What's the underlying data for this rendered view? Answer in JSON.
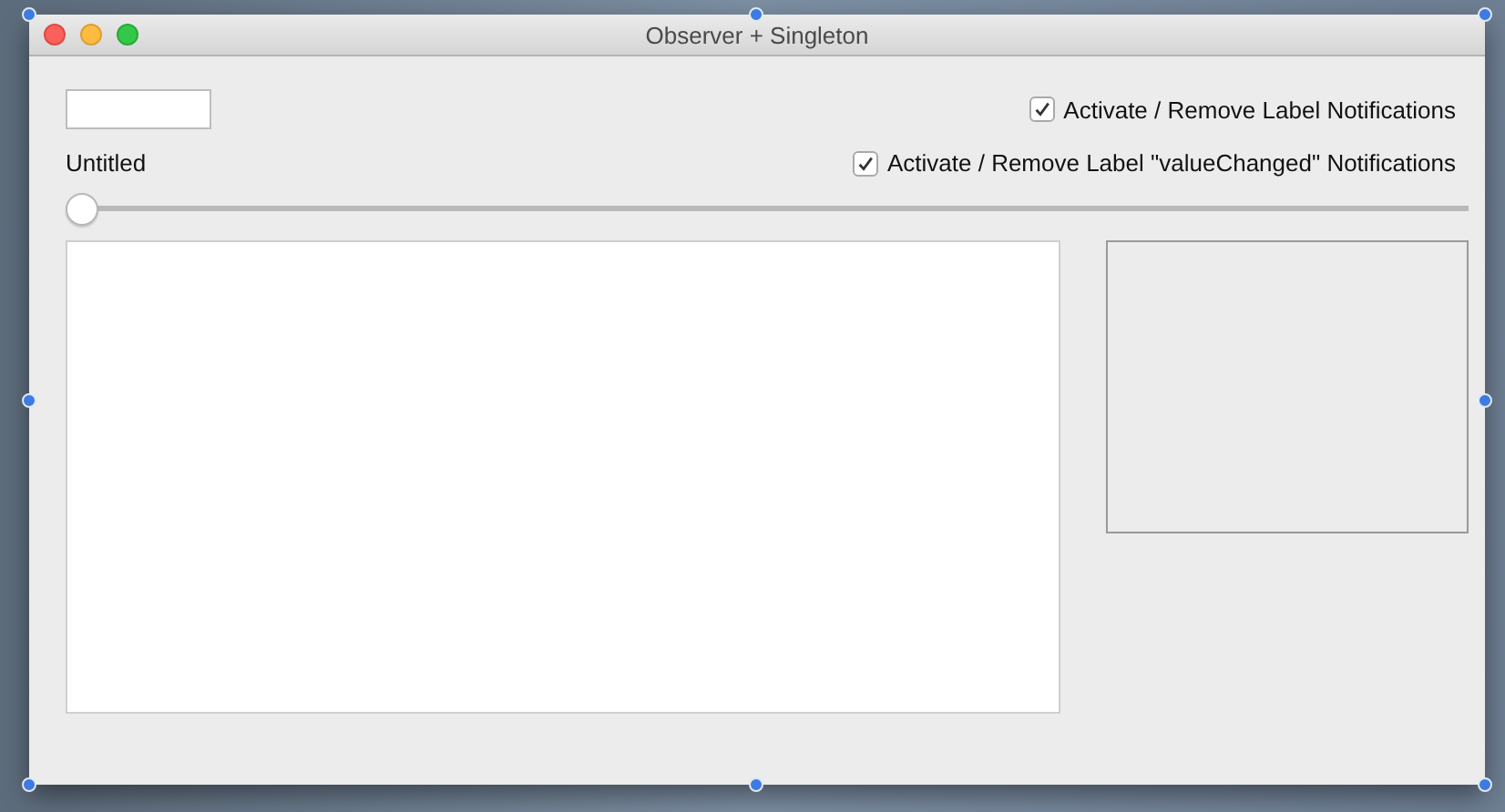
{
  "window": {
    "title": "Observer + Singleton"
  },
  "label": "Untitled",
  "checkboxes": [
    {
      "label": "Activate / Remove Label Notifications",
      "checked": true
    },
    {
      "label": "Activate / Remove Label \"valueChanged\" Notifications",
      "checked": true
    }
  ],
  "slider": {
    "level": 0
  }
}
